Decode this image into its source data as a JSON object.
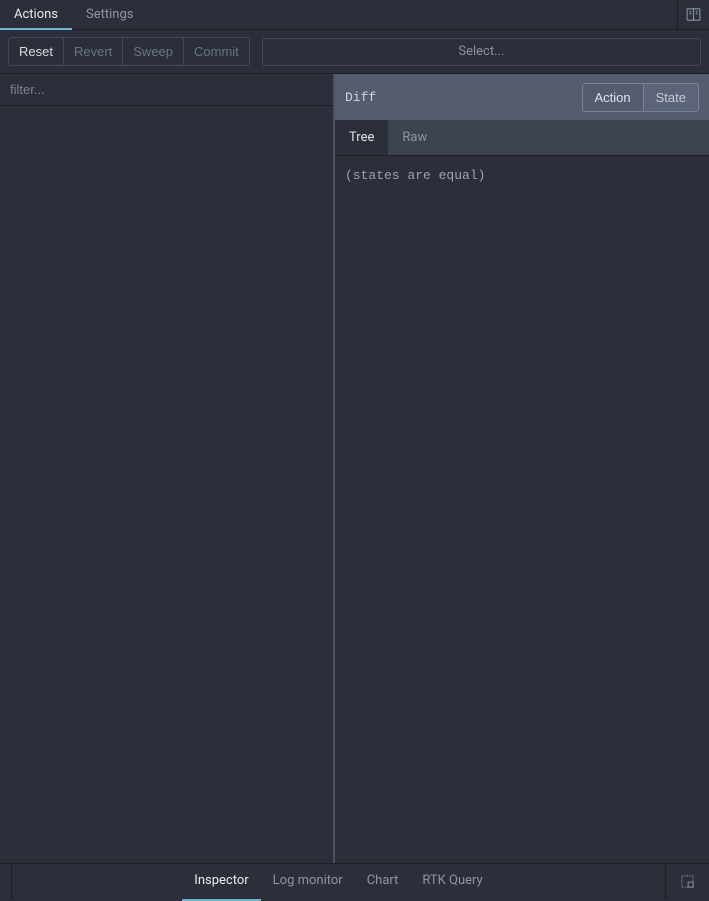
{
  "topTabs": {
    "actions": "Actions",
    "settings": "Settings"
  },
  "toolbar": {
    "reset": "Reset",
    "revert": "Revert",
    "sweep": "Sweep",
    "commit": "Commit",
    "selectPlaceholder": "Select..."
  },
  "leftPanel": {
    "filterPlaceholder": "filter..."
  },
  "rightPanel": {
    "headerLabel": "Diff",
    "actionBtn": "Action",
    "stateBtn": "State",
    "tabs": {
      "tree": "Tree",
      "raw": "Raw"
    },
    "bodyMessage": "(states are equal)"
  },
  "bottomTabs": {
    "inspector": "Inspector",
    "logMonitor": "Log monitor",
    "chart": "Chart",
    "rtkQuery": "RTK Query"
  }
}
